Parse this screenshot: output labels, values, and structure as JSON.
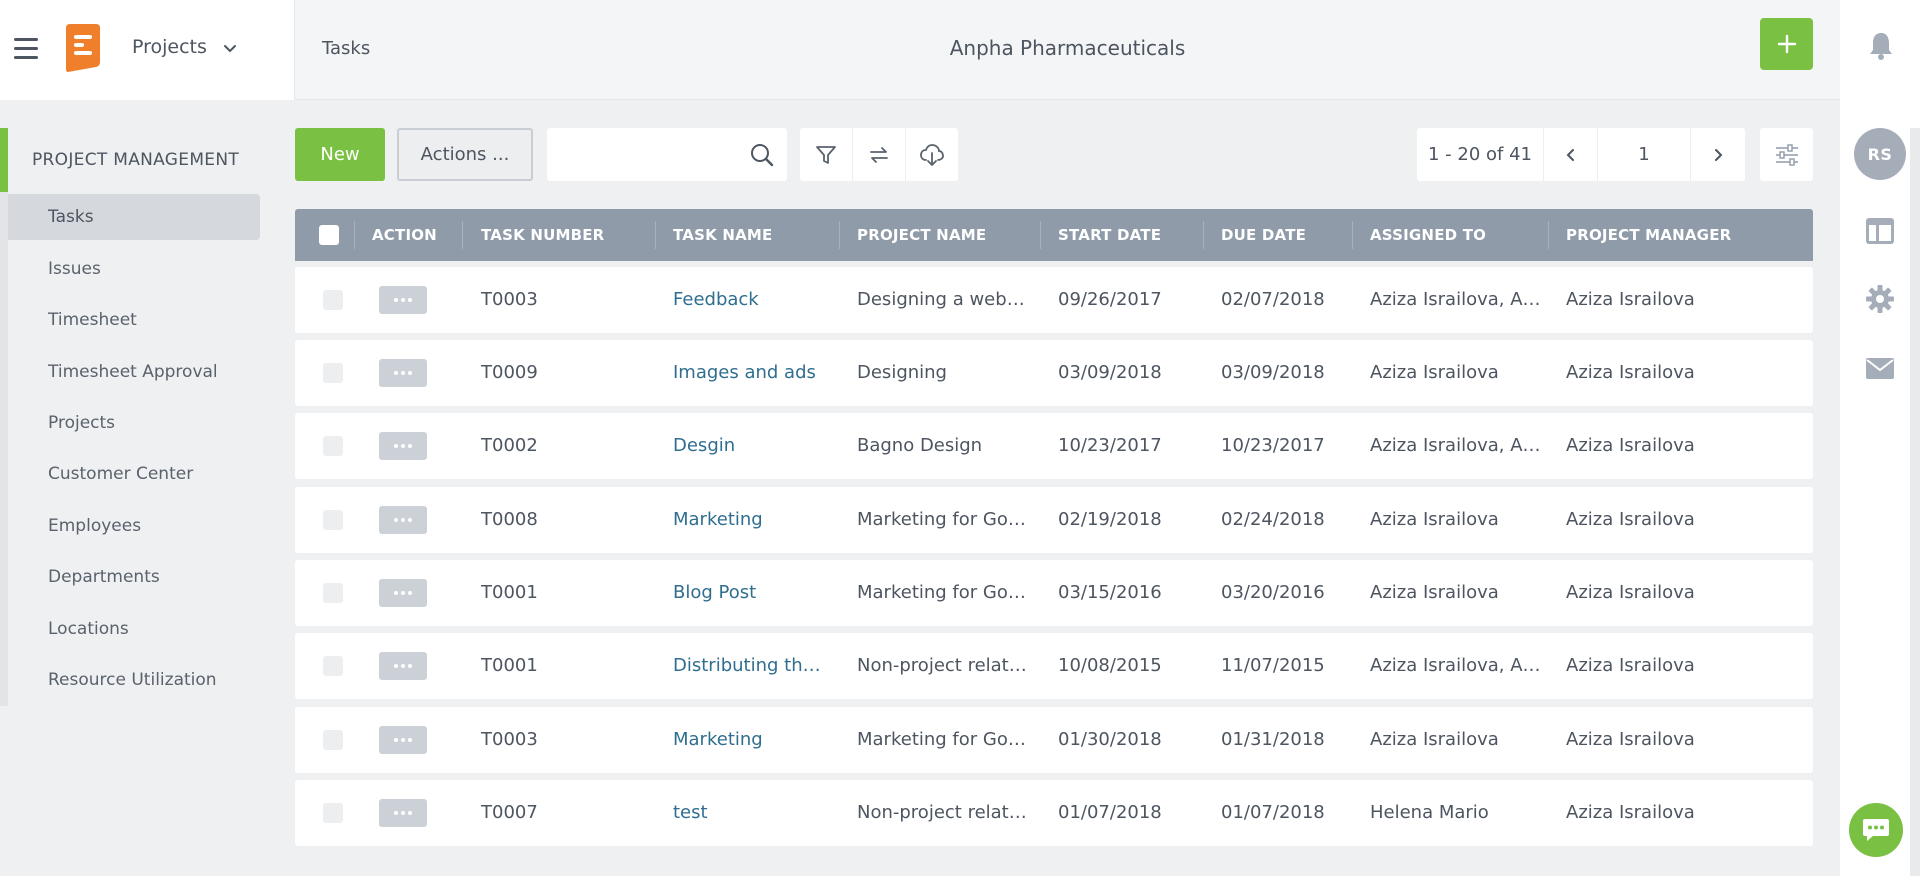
{
  "header": {
    "module_label": "Projects",
    "breadcrumb": "Tasks",
    "company": "Anpha Pharmaceuticals"
  },
  "colors": {
    "accent": "#7ac143",
    "table_header": "#8f9ba8",
    "link": "#2f6e8f",
    "logo": "#f07f2c"
  },
  "sidebar": {
    "title": "PROJECT MANAGEMENT",
    "items": [
      {
        "label": "Tasks",
        "active": true
      },
      {
        "label": "Issues"
      },
      {
        "label": "Timesheet"
      },
      {
        "label": "Timesheet Approval"
      },
      {
        "label": "Projects"
      },
      {
        "label": "Customer Center"
      },
      {
        "label": "Employees"
      },
      {
        "label": "Departments"
      },
      {
        "label": "Locations"
      },
      {
        "label": "Resource Utilization"
      }
    ]
  },
  "toolbar": {
    "new_label": "New",
    "actions_label": "Actions ...",
    "search_placeholder": ""
  },
  "pager": {
    "range": "1 - 20 of 41",
    "page": "1"
  },
  "user": {
    "initials": "RS"
  },
  "table": {
    "columns": [
      "ACTION",
      "TASK NUMBER",
      "TASK NAME",
      "PROJECT NAME",
      "START DATE",
      "DUE DATE",
      "ASSIGNED TO",
      "PROJECT MANAGER"
    ],
    "rows": [
      {
        "task_number": "T0003",
        "task_name": "Feedback",
        "project_name": "Designing a website",
        "start_date": "09/26/2017",
        "due_date": "02/07/2018",
        "assigned_to": "Aziza Israilova, Azi...",
        "project_manager": "Aziza Israilova"
      },
      {
        "task_number": "T0009",
        "task_name": "Images and ads",
        "project_name": "Designing",
        "start_date": "03/09/2018",
        "due_date": "03/09/2018",
        "assigned_to": "Aziza Israilova",
        "project_manager": "Aziza Israilova"
      },
      {
        "task_number": "T0002",
        "task_name": "Desgin",
        "project_name": "Bagno Design",
        "start_date": "10/23/2017",
        "due_date": "10/23/2017",
        "assigned_to": "Aziza Israilova, Azi...",
        "project_manager": "Aziza Israilova"
      },
      {
        "task_number": "T0008",
        "task_name": "Marketing",
        "project_name": "Marketing for Goo...",
        "start_date": "02/19/2018",
        "due_date": "02/24/2018",
        "assigned_to": "Aziza Israilova",
        "project_manager": "Aziza Israilova"
      },
      {
        "task_number": "T0001",
        "task_name": "Blog Post",
        "project_name": "Marketing for Goo...",
        "start_date": "03/15/2016",
        "due_date": "03/20/2016",
        "assigned_to": "Aziza Israilova",
        "project_manager": "Aziza Israilova"
      },
      {
        "task_number": "T0001",
        "task_name": "Distributing the ...",
        "project_name": "Non-project relate...",
        "start_date": "10/08/2015",
        "due_date": "11/07/2015",
        "assigned_to": "Aziza Israilova, Azi...",
        "project_manager": "Aziza Israilova"
      },
      {
        "task_number": "T0003",
        "task_name": "Marketing",
        "project_name": "Marketing for Goo...",
        "start_date": "01/30/2018",
        "due_date": "01/31/2018",
        "assigned_to": "Aziza Israilova",
        "project_manager": "Aziza Israilova"
      },
      {
        "task_number": "T0007",
        "task_name": "test",
        "project_name": "Non-project relate...",
        "start_date": "01/07/2018",
        "due_date": "01/07/2018",
        "assigned_to": "Helena Mario",
        "project_manager": "Aziza Israilova"
      }
    ]
  },
  "icons": [
    "hamburger-icon",
    "app-logo",
    "chevron-down-icon",
    "plus-icon",
    "bell-icon",
    "search-icon",
    "filter-icon",
    "refresh-icon",
    "cloud-download-icon",
    "chevron-left-icon",
    "chevron-right-icon",
    "sliders-icon",
    "layout-icon",
    "gear-icon",
    "mail-icon",
    "chat-icon",
    "more-dots-icon"
  ]
}
